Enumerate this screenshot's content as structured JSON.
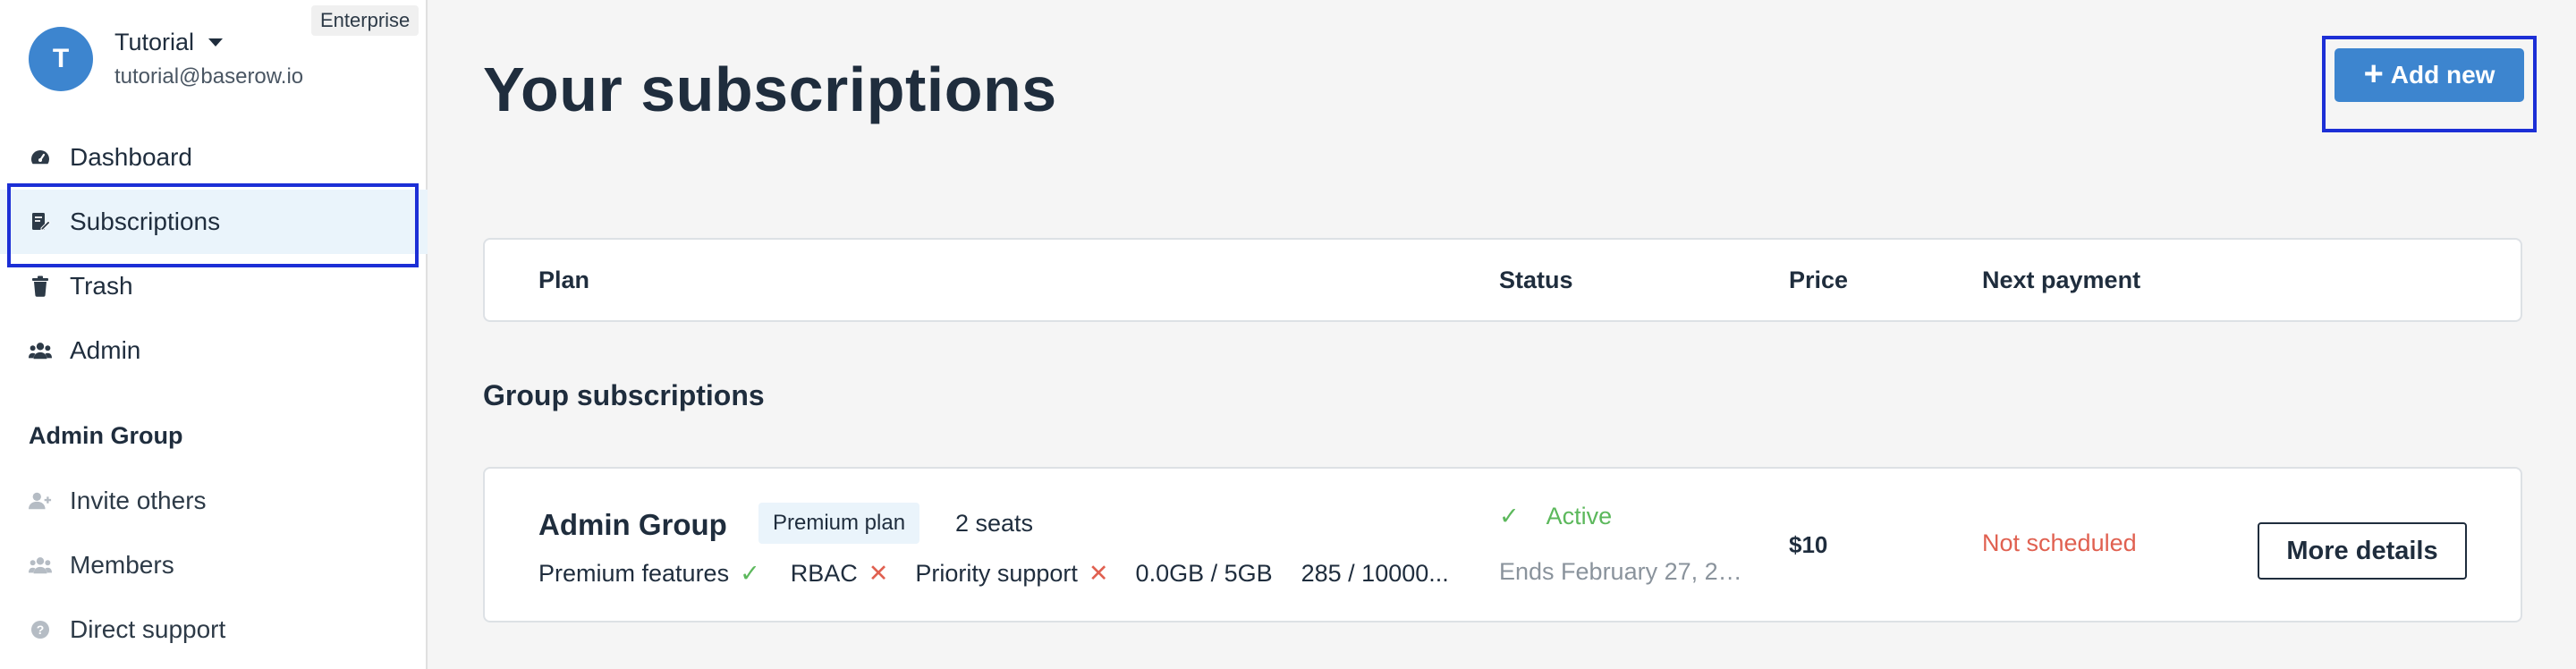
{
  "account": {
    "initial": "T",
    "name": "Tutorial",
    "email": "tutorial@baserow.io",
    "badge": "Enterprise"
  },
  "sidebar": {
    "items": [
      {
        "label": "Dashboard",
        "icon": "dashboard-icon"
      },
      {
        "label": "Subscriptions",
        "icon": "subscriptions-icon"
      },
      {
        "label": "Trash",
        "icon": "trash-icon"
      },
      {
        "label": "Admin",
        "icon": "admin-icon"
      }
    ],
    "group_title": "Admin Group",
    "group_items": [
      {
        "label": "Invite others",
        "icon": "invite-user-icon"
      },
      {
        "label": "Members",
        "icon": "members-icon"
      },
      {
        "label": "Direct support",
        "icon": "help-icon"
      }
    ]
  },
  "main": {
    "title": "Your subscriptions",
    "add_button": "Add new",
    "columns": [
      "Plan",
      "Status",
      "Price",
      "Next payment"
    ],
    "group_title": "Group subscriptions",
    "subscription": {
      "name": "Admin Group",
      "plan": "Premium plan",
      "seats": "2 seats",
      "features": {
        "premium": "Premium features",
        "rbac": "RBAC",
        "support": "Priority support",
        "storage": "0.0GB / 5GB",
        "rows": "285 / 10000..."
      },
      "status": "Active",
      "status_sub": "Ends February 27, 20...",
      "price": "$10",
      "next_payment": "Not scheduled",
      "more_button": "More details"
    }
  },
  "colors": {
    "accent": "#3d85cf",
    "success": "#5cb85c",
    "danger": "#e06050",
    "highlight_box": "#1c2fd6"
  }
}
